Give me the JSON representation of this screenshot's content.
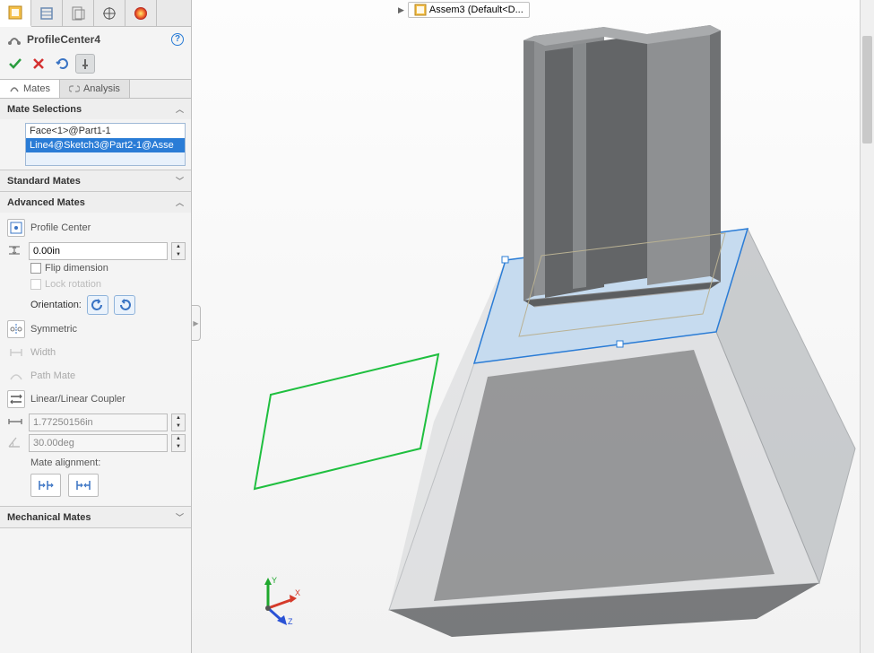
{
  "breadcrumb": {
    "item": "Assem3 (Default<D..."
  },
  "featureTitle": "ProfileCenter4",
  "subtabs": {
    "mates": "Mates",
    "analysis": "Analysis"
  },
  "sections": {
    "mateSelections": {
      "title": "Mate Selections",
      "items": [
        "Face<1>@Part1-1",
        "Line4@Sketch3@Part2-1@Asse"
      ]
    },
    "standardMates": {
      "title": "Standard Mates"
    },
    "advancedMates": {
      "title": "Advanced Mates",
      "profileCenter": "Profile Center",
      "offset": "0.00in",
      "flipDimension": "Flip dimension",
      "lockRotation": "Lock rotation",
      "orientation": "Orientation:",
      "symmetric": "Symmetric",
      "width": "Width",
      "pathMate": "Path Mate",
      "linearCoupler": "Linear/Linear Coupler",
      "couplerValue": "1.77250156in",
      "angleValue": "30.00deg",
      "mateAlignment": "Mate alignment:"
    },
    "mechanicalMates": {
      "title": "Mechanical Mates"
    }
  },
  "triad": {
    "x": "X",
    "y": "Y",
    "z": "Z"
  }
}
